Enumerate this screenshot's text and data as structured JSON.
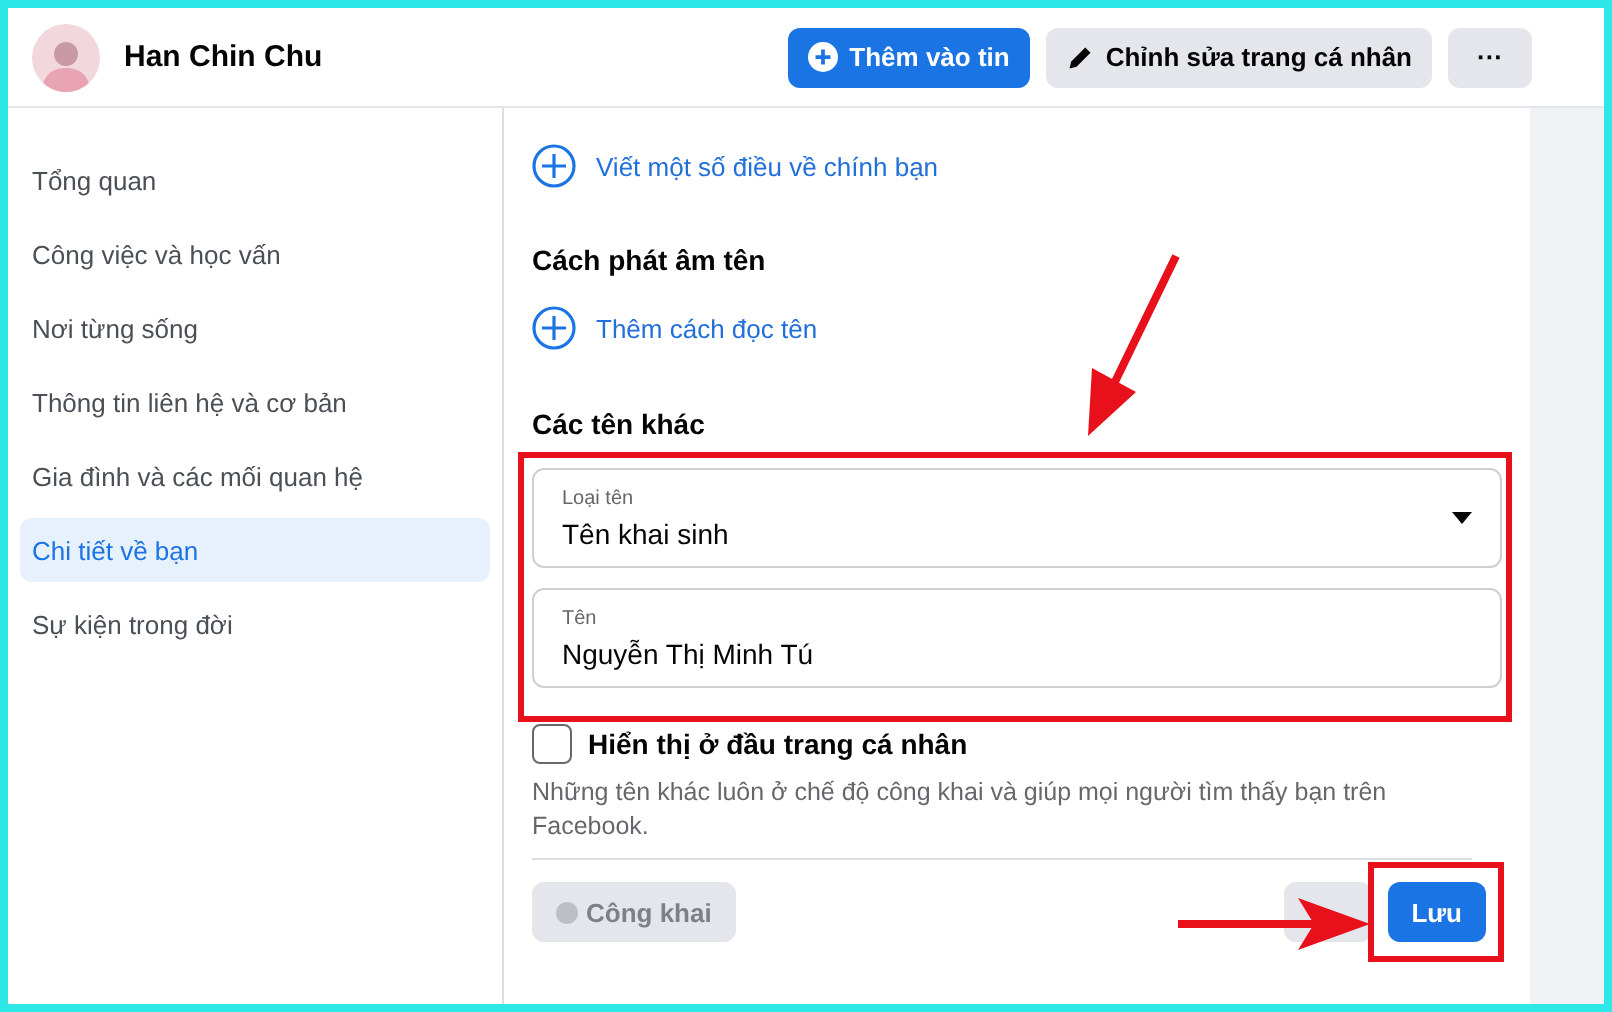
{
  "header": {
    "profile_name": "Han Chin Chu",
    "buttons": [
      {
        "kind": "primary",
        "label": "Thêm vào tin"
      },
      {
        "kind": "edit",
        "label": "Chỉnh sửa trang cá nhân"
      },
      {
        "kind": "more",
        "label": "···"
      }
    ]
  },
  "sidebar": {
    "items": [
      {
        "label": "Tổng quan",
        "selected": false
      },
      {
        "label": "Công việc và học vấn",
        "selected": false
      },
      {
        "label": "Nơi từng sống",
        "selected": false
      },
      {
        "label": "Thông tin liên hệ và cơ bản",
        "selected": false
      },
      {
        "label": "Gia đình và các mối quan hệ",
        "selected": false
      },
      {
        "label": "Chi tiết về bạn",
        "selected": true
      },
      {
        "label": "Sự kiện trong đời",
        "selected": false
      }
    ]
  },
  "content": {
    "about_link": "Viết một số điều về chính bạn",
    "pronunciation": {
      "title": "Cách phát âm tên",
      "link": "Thêm cách đọc tên"
    },
    "other_names": {
      "title": "Các tên khác",
      "name_type": {
        "label": "Loại tên",
        "value": "Tên khai sinh"
      },
      "name": {
        "label": "Tên",
        "value": "Nguyễn Thị Minh Tú"
      },
      "show_at_top": {
        "label": "Hiển thị ở đầu trang cá nhân",
        "checked": false
      },
      "note": "Những tên khác luôn ở chế độ công khai và giúp mọi người tìm thấy bạn trên Facebook.",
      "privacy": "Công khai",
      "save": "Lưu"
    }
  }
}
